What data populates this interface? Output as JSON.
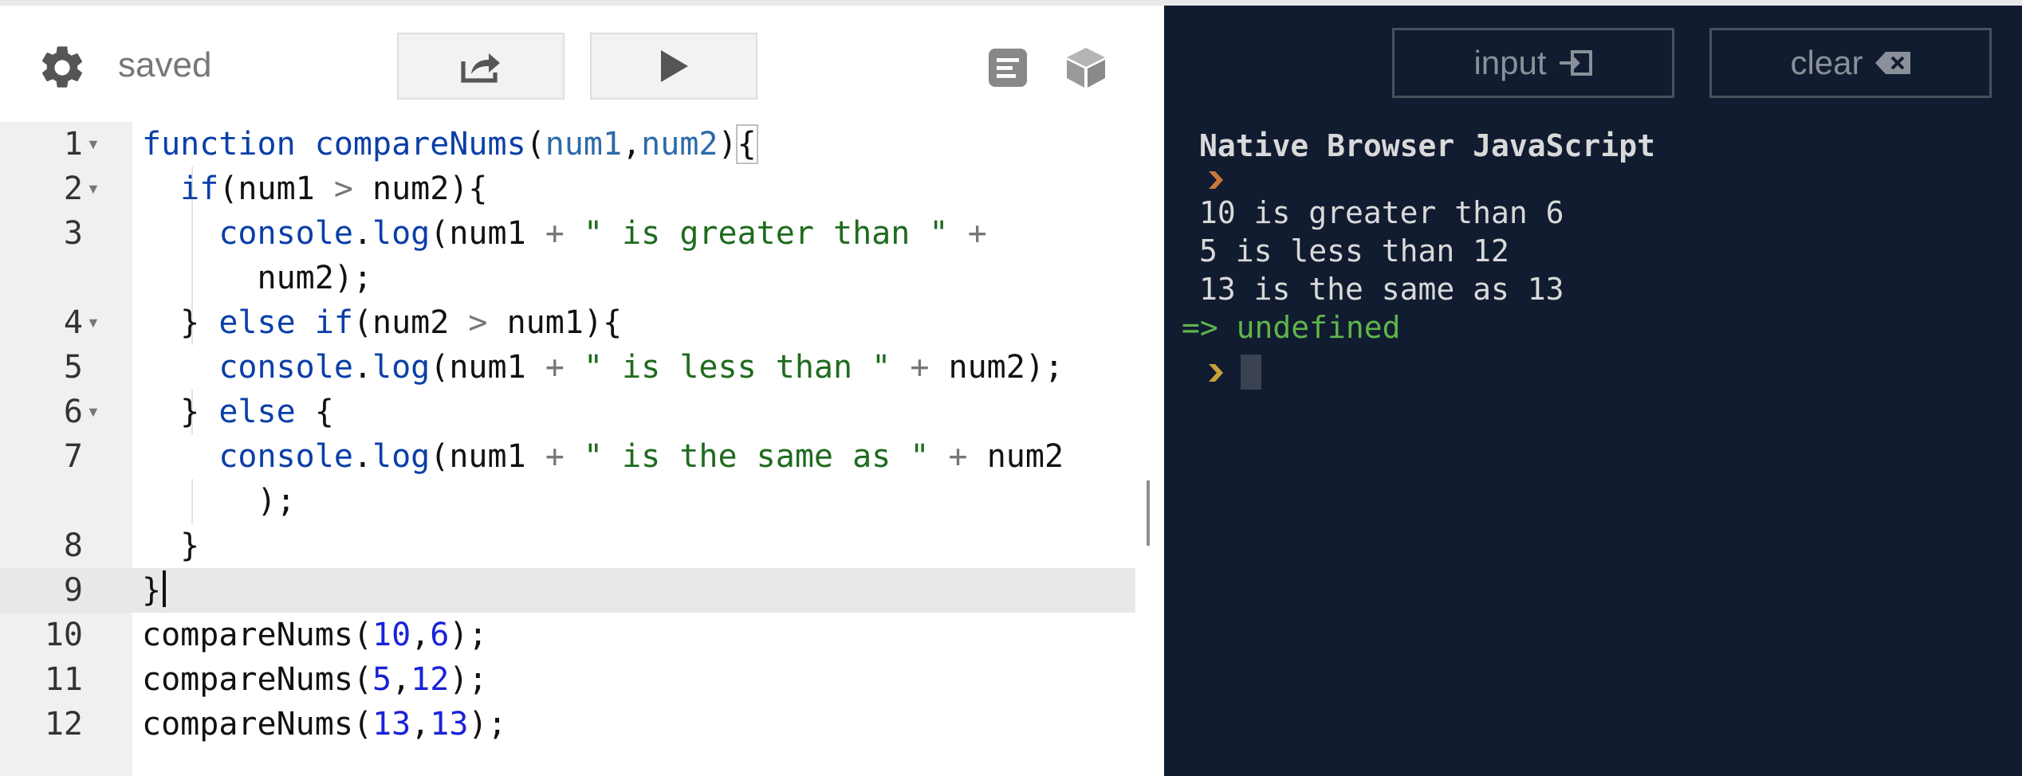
{
  "toolbar": {
    "status": "saved",
    "settings_icon": "gear-icon",
    "share_icon": "share-icon",
    "run_icon": "play-icon",
    "outline_icon": "outline-icon",
    "packages_icon": "package-cube-icon"
  },
  "editor": {
    "line_numbers": [
      "1",
      "2",
      "3",
      "",
      "4",
      "5",
      "6",
      "7",
      "",
      "8",
      "9",
      "10",
      "11",
      "12"
    ],
    "code_lines": [
      "function compareNums(num1,num2){",
      "  if(num1 > num2){",
      "    console.log(num1 + \" is greater than \" +",
      "      num2);",
      "  } else if(num2 > num1){",
      "    console.log(num1 + \" is less than \" + num2);",
      "  } else {",
      "    console.log(num1 + \" is the same as \" + num2",
      "      );",
      "  }",
      "}",
      "compareNums(10,6);",
      "compareNums(5,12);",
      "compareNums(13,13);"
    ],
    "active_line": "9"
  },
  "console": {
    "input_label": "input",
    "input_icon": "enter-input-icon",
    "clear_label": "clear",
    "clear_icon": "backspace-icon",
    "header": "Native Browser JavaScript",
    "output": [
      "10 is greater than 6",
      "5 is less than 12",
      "13 is the same as 13"
    ],
    "return_prefix": "=>",
    "return_value": "undefined"
  },
  "colors": {
    "console_bg": "#111c30",
    "keyword": "#0a3fa8",
    "string": "#1f6b1f",
    "number": "#1a22d8",
    "return_green": "#5fb54a",
    "prompt_orange": "#c9783a"
  }
}
